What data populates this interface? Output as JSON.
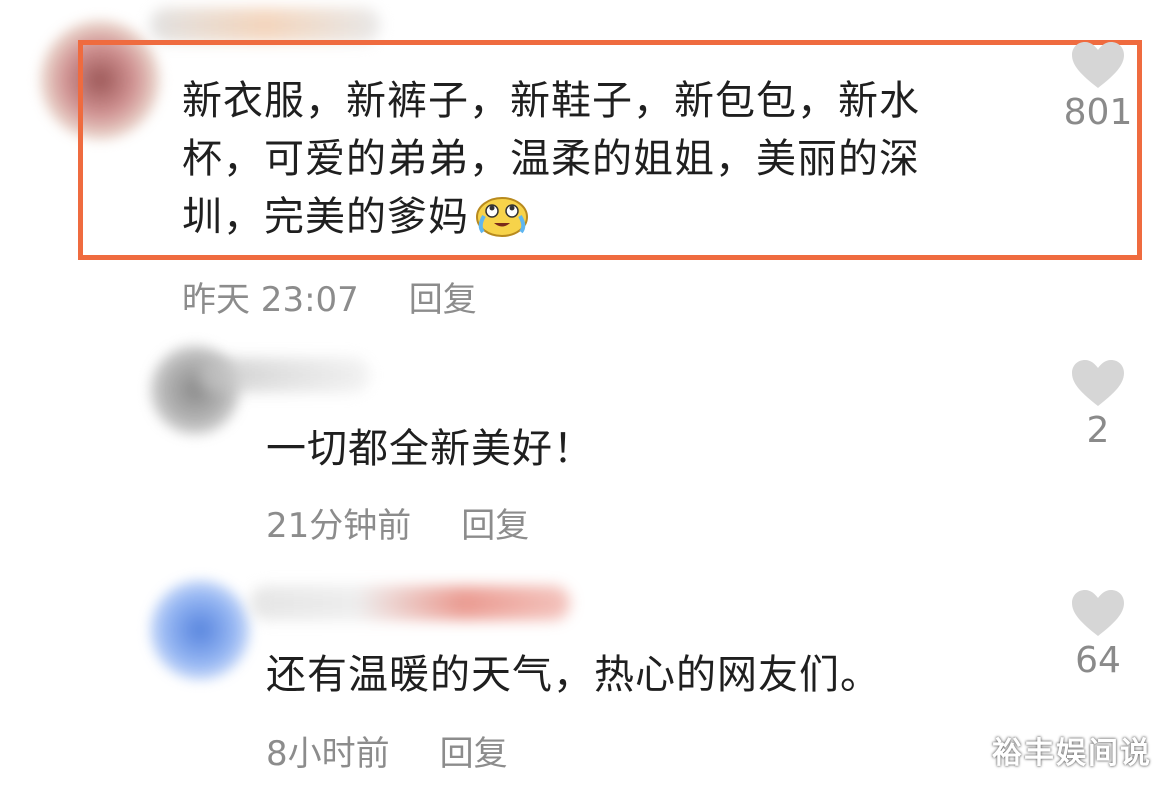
{
  "comments": [
    {
      "text_lines": [
        "新衣服，新裤子，新鞋子，新包包，新水",
        "杯，可爱的弟弟，温柔的姐姐，美丽的深",
        "圳，完美的爹妈"
      ],
      "emoji": "crying-laughing-emoji",
      "time": "昨天 23:07",
      "reply_label": "回复",
      "likes": "801",
      "highlighted": true
    },
    {
      "text": "一切都全新美好！",
      "time": "21分钟前",
      "reply_label": "回复",
      "likes": "2"
    },
    {
      "text": "还有温暖的天气，热心的网友们。",
      "time": "8小时前",
      "reply_label": "回复",
      "likes": "64"
    }
  ],
  "icons": {
    "like": "heart-icon"
  },
  "colors": {
    "highlight_border": "#ef6b3f",
    "meta_text": "#8c8c8c",
    "heart": "#d6d6d6"
  },
  "watermark": "裕丰娱间说"
}
